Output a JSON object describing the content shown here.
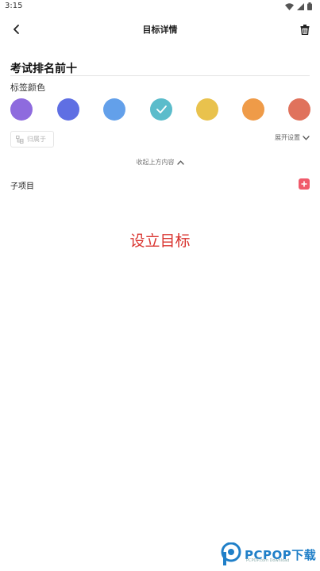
{
  "status_bar": {
    "time": "3:15"
  },
  "header": {
    "title": "目标详情"
  },
  "goal": {
    "name": "考试排名前十"
  },
  "tag_color": {
    "label": "标签颜色",
    "colors": [
      "#8e6bde",
      "#5f6fe3",
      "#63a0ea",
      "#5bbccb",
      "#e9c24d",
      "#ef9b48",
      "#e0725c"
    ],
    "selected_index": 3
  },
  "options": {
    "chip_label": "归属于",
    "expand_label": "展开设置"
  },
  "collapse": {
    "label": "收起上方内容"
  },
  "subitems": {
    "label": "子项目"
  },
  "overlay": {
    "text": "设立目标"
  },
  "watermark": {
    "brand": "PCPOP下载",
    "sub": "PCPOP.com Download"
  }
}
